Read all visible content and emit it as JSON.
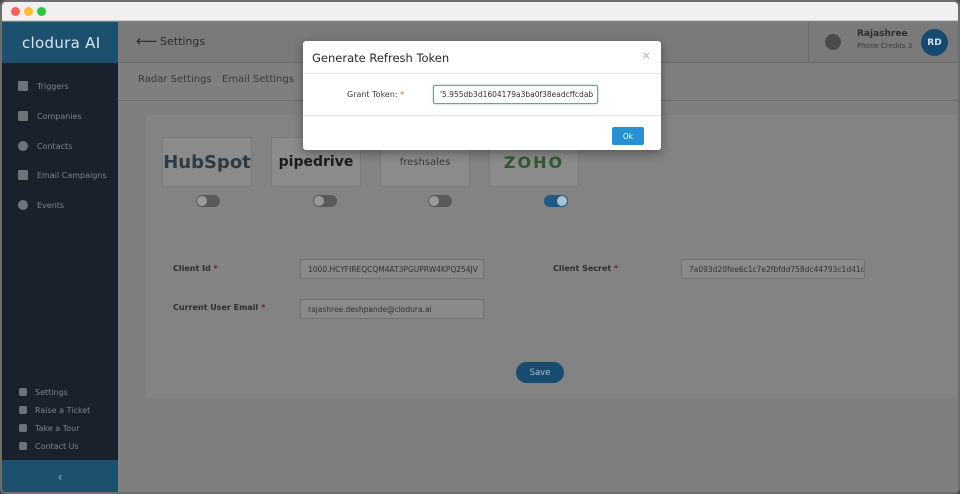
{
  "app": {
    "brand": "clodura AI"
  },
  "sidebar": {
    "items": [
      {
        "label": "Triggers",
        "icon": "grid-icon"
      },
      {
        "label": "Companies",
        "icon": "building-icon"
      },
      {
        "label": "Contacts",
        "icon": "user-icon"
      },
      {
        "label": "Email Campaigns",
        "icon": "envelope-icon"
      },
      {
        "label": "Events",
        "icon": "twitter-icon"
      }
    ],
    "bottom_items": [
      {
        "label": "Settings",
        "icon": "gear-icon"
      },
      {
        "label": "Raise a Ticket",
        "icon": "envelope-icon"
      },
      {
        "label": "Take a Tour",
        "icon": "video-icon"
      },
      {
        "label": "Contact Us",
        "icon": "phone-icon"
      }
    ],
    "collapse_glyph": "‹"
  },
  "header": {
    "back_glyph": "⟵",
    "title": "Settings",
    "user_name": "Rajashree",
    "user_credits": "Phone Credits  3",
    "avatar_initials": "RD"
  },
  "tabs": [
    {
      "label": "Radar Settings"
    },
    {
      "label": "Email Settings"
    }
  ],
  "integrations": [
    {
      "name": "HubSpot",
      "text": "HubSpot",
      "enabled": false
    },
    {
      "name": "pipedrive",
      "text": "pipedrive",
      "enabled": false
    },
    {
      "name": "freshsales",
      "text": "freshsales",
      "enabled": false
    },
    {
      "name": "ZOHO",
      "text": "ZOHO",
      "enabled": true
    }
  ],
  "form": {
    "client_id_label": "Client Id",
    "client_id_value": "1000.HCYFIREQCQM4AT3PGUPRW4KPQ254JV",
    "client_secret_label": "Client Secret",
    "client_secret_value": "7a093d20fee6c1c7e2fbfdd758dc44793c1d41dd",
    "email_label": "Current User Email",
    "email_value": "rajashree.deshpande@clodura.ai",
    "required_mark": "*",
    "save_label": "Save"
  },
  "modal": {
    "title": "Generate Refresh Token",
    "close_glyph": "×",
    "grant_label": "Grant Token:",
    "required_mark": "*",
    "grant_value": "'5.955db3d1604179a3ba0f38eadcffcdab",
    "ok_label": "Ok"
  },
  "colors": {
    "sidebar_bg": "#19222c",
    "brand_bg": "#1d4f6f",
    "primary_button": "#2791d4",
    "toggle_on": "#1e5a85"
  }
}
